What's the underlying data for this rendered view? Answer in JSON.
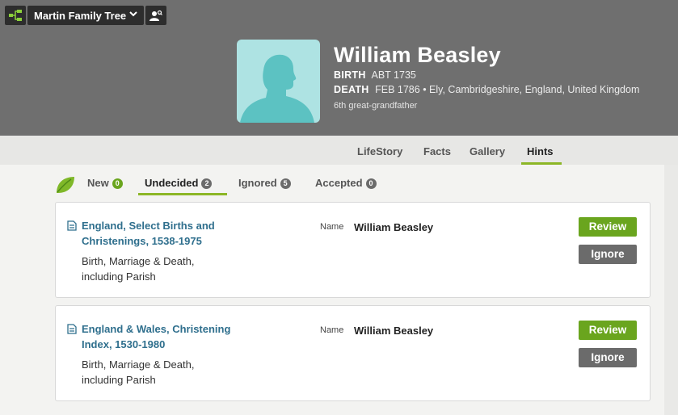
{
  "tree": {
    "name": "Martin Family Tree"
  },
  "person": {
    "name": "William Beasley",
    "birth_label": "BIRTH",
    "birth_value": "ABT 1735",
    "death_label": "DEATH",
    "death_value": "FEB 1786 • Ely, Cambridgeshire, England, United Kingdom",
    "relation": "6th great-grandfather"
  },
  "nav": {
    "tabs": [
      {
        "label": "LifeStory"
      },
      {
        "label": "Facts"
      },
      {
        "label": "Gallery"
      },
      {
        "label": "Hints",
        "active": true
      }
    ]
  },
  "filters": [
    {
      "label": "New",
      "count": "0",
      "badge_color": "#6aa51e"
    },
    {
      "label": "Undecided",
      "count": "2",
      "badge_color": "#6b6b6b",
      "active": true
    },
    {
      "label": "Ignored",
      "count": "5",
      "badge_color": "#6b6b6b"
    },
    {
      "label": "Accepted",
      "count": "0",
      "badge_color": "#6b6b6b"
    }
  ],
  "hints": [
    {
      "title": "England, Select Births and Christenings, 1538-1975",
      "description": "Birth, Marriage & Death, including Parish",
      "name_label": "Name",
      "name_value": "William Beasley",
      "review_label": "Review",
      "ignore_label": "Ignore"
    },
    {
      "title": "England & Wales, Christening Index, 1530-1980",
      "description": "Birth, Marriage & Death, including Parish",
      "name_label": "Name",
      "name_value": "William Beasley",
      "review_label": "Review",
      "ignore_label": "Ignore"
    }
  ],
  "colors": {
    "header_bg": "#6f6f6f",
    "accent_green": "#6aa51e",
    "underline_green": "#8cb626",
    "link_blue": "#2f6f8d",
    "avatar_bg": "#aee3e3",
    "avatar_silhouette": "#5cc2c2"
  }
}
